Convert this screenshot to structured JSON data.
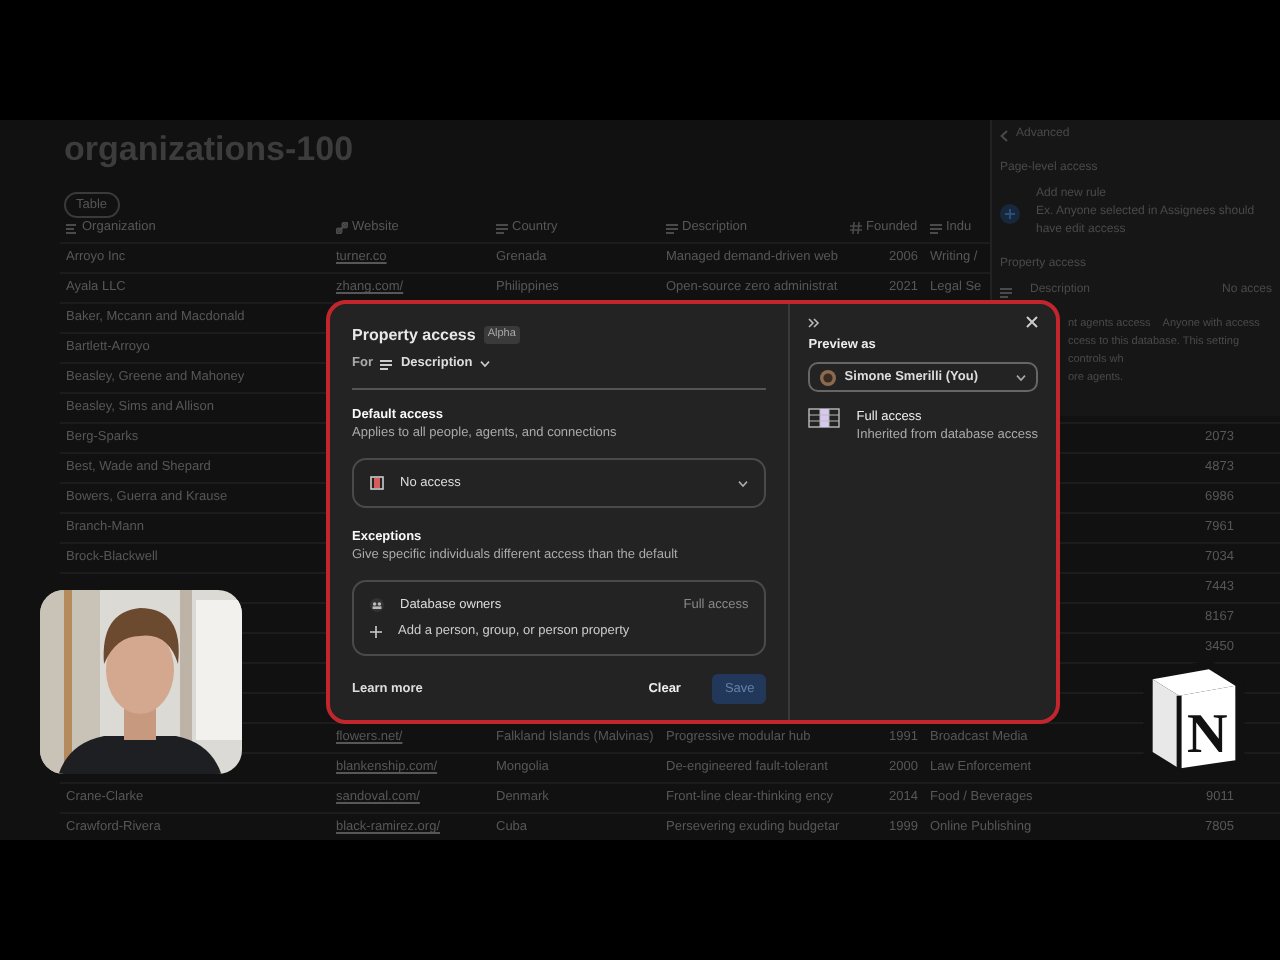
{
  "database": {
    "title": "organizations-100",
    "view_tab": "Table",
    "columns": [
      {
        "label": "Organization",
        "kind": "title"
      },
      {
        "label": "Website",
        "kind": "link"
      },
      {
        "label": "Country",
        "kind": "text"
      },
      {
        "label": "Description",
        "kind": "text"
      },
      {
        "label": "Founded",
        "kind": "number"
      },
      {
        "label": "Indu",
        "kind": "text"
      }
    ],
    "rows": [
      {
        "organization": "Arroyo Inc",
        "website": "turner.co",
        "country": "Grenada",
        "description": "Managed demand-driven web",
        "founded": "2006",
        "industry": "Writing /"
      },
      {
        "organization": "Ayala LLC",
        "website": "zhang.com/",
        "country": "Philippines",
        "description": "Open-source zero administrat",
        "founded": "2021",
        "industry": "Legal Se"
      },
      {
        "organization": "Baker, Mccann and Macdonald"
      },
      {
        "organization": "Bartlett-Arroyo"
      },
      {
        "organization": "Beasley, Greene and Mahoney"
      },
      {
        "organization": "Beasley, Sims and Allison"
      },
      {
        "organization": "Berg-Sparks",
        "column_7": "2073"
      },
      {
        "organization": "Best, Wade and Shepard",
        "column_7": "4873"
      },
      {
        "organization": "Bowers, Guerra and Krause",
        "column_7": "6986"
      },
      {
        "organization": "Branch-Mann",
        "column_7": "7961"
      },
      {
        "organization": "Brock-Blackwell",
        "column_7": "7034"
      },
      {
        "column_7": "7443"
      },
      {
        "column_7": "8167"
      },
      {
        "column_7": "3450"
      },
      {},
      {},
      {
        "website": "flowers.net/",
        "country": "Falkland Islands (Malvinas)",
        "description": "Progressive modular hub",
        "founded": "1991",
        "industry": "Broadcast Media"
      },
      {
        "website": "blankenship.com/",
        "country": "Mongolia",
        "description": "De-engineered fault-tolerant",
        "founded": "2000",
        "industry": "Law Enforcement"
      },
      {
        "organization": "Crane-Clarke",
        "website": "sandoval.com/",
        "country": "Denmark",
        "description": "Front-line clear-thinking ency",
        "founded": "2014",
        "industry": "Food / Beverages",
        "column_7": "9011"
      },
      {
        "organization": "Crawford-Rivera",
        "website": "black-ramirez.org/",
        "country": "Cuba",
        "description": "Persevering exuding budgetar",
        "founded": "1999",
        "industry": "Online Publishing",
        "column_7": "7805"
      }
    ]
  },
  "side_panel": {
    "title": "Advanced",
    "section_1": "Page-level access",
    "rule_title": "Add new rule",
    "rule_hint": "Ex. Anyone selected in Assignees should have edit access",
    "section_2": "Property access",
    "property": "Description",
    "property_access": "No acces",
    "tabs": [
      "nt agents access",
      "Anyone with access"
    ],
    "note": [
      "ccess to this database. This setting controls wh",
      "ore agents."
    ]
  },
  "dialog": {
    "title": "Property access",
    "badge": "Alpha",
    "for_label": "For",
    "property": "Description",
    "default_title": "Default access",
    "default_desc": "Applies to all people, agents, and connections",
    "default_value": "No access",
    "exceptions_title": "Exceptions",
    "exceptions_desc": "Give specific individuals different access than the default",
    "exceptions": [
      {
        "label": "Database owners",
        "access": "Full access"
      }
    ],
    "add_label": "Add a person, group, or person property",
    "learn_more": "Learn more",
    "clear": "Clear",
    "save": {
      "label": "Save",
      "disabled": true
    },
    "preview_label": "Preview as",
    "preview_user": "Simone Smerilli (You)",
    "result_title": "Full access",
    "result_desc": "Inherited from database access"
  },
  "logo": {
    "letter": "N"
  }
}
